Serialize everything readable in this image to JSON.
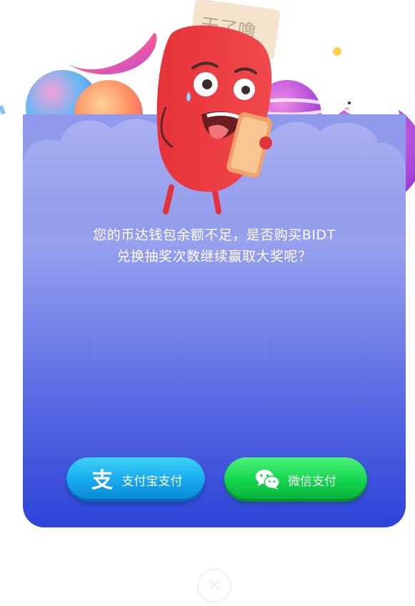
{
  "mascot": {
    "sign_text": "天了噜"
  },
  "dialog": {
    "message_line1": "您的币达钱包余额不足，是否购买BIDT",
    "message_line2": "兑换抽奖次数继续赢取大奖呢？"
  },
  "buttons": {
    "alipay_label": "支付宝支付",
    "wechat_label": "微信支付"
  },
  "colors": {
    "panel_top": "#9aa3ee",
    "panel_bottom": "#2c44d8",
    "alipay": "#15a6ec",
    "wechat": "#12d24c"
  },
  "icons": {
    "alipay": "alipay-icon",
    "wechat": "wechat-icon",
    "close": "close-icon"
  }
}
